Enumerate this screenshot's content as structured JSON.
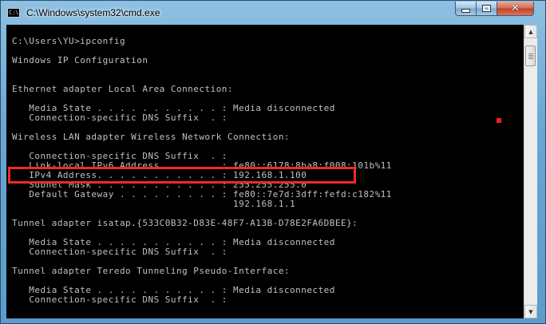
{
  "window": {
    "title": "C:\\Windows\\system32\\cmd.exe",
    "icon": "cmd-icon",
    "controls": {
      "minimize": "minimize-icon",
      "maximize": "maximize-icon",
      "close": "✕"
    }
  },
  "console": {
    "lines": [
      "C:\\Users\\YU>ipconfig",
      "Windows IP Configuration",
      "Ethernet adapter Local Area Connection:",
      "   Media State . . . . . . . . . . . : Media disconnected",
      "   Connection-specific DNS Suffix  . :",
      "Wireless LAN adapter Wireless Network Connection:",
      "   Connection-specific DNS Suffix  . :",
      "   Link-local IPv6 Address . . . . . : fe80::6178:8ba8:f008:101b%11",
      "   IPv4 Address. . . . . . . . . . . : 192.168.1.100",
      "   Subnet Mask . . . . . . . . . . . : 255.255.255.0",
      "   Default Gateway . . . . . . . . . : fe80::7e7d:3dff:fefd:c182%11",
      "                                       192.168.1.1",
      "Tunnel adapter isatap.{533C0B32-D83E-48F7-A13B-D78E2FA6DBEE}:",
      "   Media State . . . . . . . . . . . : Media disconnected",
      "   Connection-specific DNS Suffix  . :",
      "Tunnel adapter Teredo Tunneling Pseudo-Interface:",
      "   Media State . . . . . . . . . . . : Media disconnected",
      "   Connection-specific DNS Suffix  . :"
    ],
    "text_color": "#c0c0c0",
    "background": "#000000",
    "highlight_color": "#ee2b24"
  },
  "scrollbar": {
    "up_icon": "▲",
    "down_icon": "▼"
  }
}
